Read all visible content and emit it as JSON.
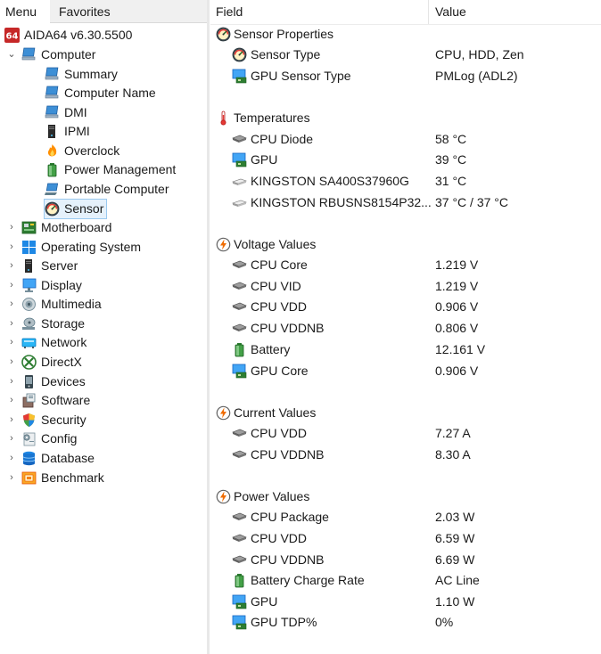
{
  "tabs": {
    "menu": "Menu",
    "favorites": "Favorites"
  },
  "tree": {
    "root": "AIDA64 v6.30.5500",
    "computer": "Computer",
    "computer_children": [
      "Summary",
      "Computer Name",
      "DMI",
      "IPMI",
      "Overclock",
      "Power Management",
      "Portable Computer",
      "Sensor"
    ],
    "selected": "Sensor",
    "categories": [
      "Motherboard",
      "Operating System",
      "Server",
      "Display",
      "Multimedia",
      "Storage",
      "Network",
      "DirectX",
      "Devices",
      "Software",
      "Security",
      "Config",
      "Database",
      "Benchmark"
    ]
  },
  "columns": {
    "field": "Field",
    "value": "Value"
  },
  "sections": {
    "sensor_properties": {
      "title": "Sensor Properties",
      "rows": [
        {
          "field": "Sensor Type",
          "value": "CPU, HDD, Zen"
        },
        {
          "field": "GPU Sensor Type",
          "value": "PMLog  (ADL2)"
        }
      ]
    },
    "temperatures": {
      "title": "Temperatures",
      "rows": [
        {
          "field": "CPU Diode",
          "value": "58 °C"
        },
        {
          "field": "GPU",
          "value": "39 °C"
        },
        {
          "field": "KINGSTON SA400S37960G",
          "value": "31 °C"
        },
        {
          "field": "KINGSTON RBUSNS8154P32...",
          "value": "37 °C / 37 °C"
        }
      ]
    },
    "voltage": {
      "title": "Voltage Values",
      "rows": [
        {
          "field": "CPU Core",
          "value": "1.219 V"
        },
        {
          "field": "CPU VID",
          "value": "1.219 V"
        },
        {
          "field": "CPU VDD",
          "value": "0.906 V"
        },
        {
          "field": "CPU VDDNB",
          "value": "0.806 V"
        },
        {
          "field": "Battery",
          "value": "12.161 V"
        },
        {
          "field": "GPU Core",
          "value": "0.906 V"
        }
      ]
    },
    "current": {
      "title": "Current Values",
      "rows": [
        {
          "field": "CPU VDD",
          "value": "7.27 A"
        },
        {
          "field": "CPU VDDNB",
          "value": "8.30 A"
        }
      ]
    },
    "power": {
      "title": "Power Values",
      "rows": [
        {
          "field": "CPU Package",
          "value": "2.03 W"
        },
        {
          "field": "CPU VDD",
          "value": "6.59 W"
        },
        {
          "field": "CPU VDDNB",
          "value": "6.69 W"
        },
        {
          "field": "Battery Charge Rate",
          "value": "AC Line"
        },
        {
          "field": "GPU",
          "value": "1.10 W"
        },
        {
          "field": "GPU TDP%",
          "value": "0%"
        }
      ]
    }
  },
  "colors": {
    "selection_bg": "#e5f1fb",
    "selection_border": "#99c9ef",
    "aida_red": "#c62828"
  },
  "icons": {
    "root": "aida64-logo-icon",
    "computer": "computer-icon",
    "sensor": "sensor-gauge-icon",
    "temperature": "thermometer-icon",
    "lightning": "lightning-icon",
    "chip": "chip-icon",
    "gpu": "gpu-monitor-icon",
    "drive": "drive-icon",
    "battery": "battery-icon"
  }
}
